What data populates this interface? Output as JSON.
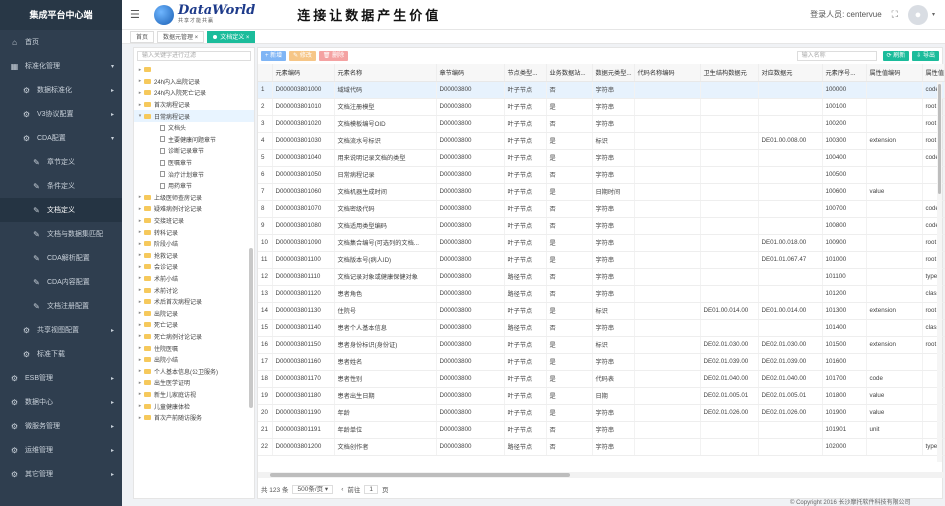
{
  "app": {
    "title": "集成平台中心端"
  },
  "sidebar": {
    "items": [
      {
        "label": "首页",
        "icon": "home-icon",
        "glyph": "⌂",
        "level": 0
      },
      {
        "label": "标准化管理",
        "icon": "grid-icon",
        "glyph": "▦",
        "level": 0,
        "arrow": "▾"
      },
      {
        "label": "数据标准化",
        "icon": "gear-icon",
        "glyph": "⚙",
        "level": 1,
        "arrow": "▸"
      },
      {
        "label": "V3协议配置",
        "icon": "gear-icon",
        "glyph": "⚙",
        "level": 1,
        "arrow": "▸"
      },
      {
        "label": "CDA配置",
        "icon": "gear-icon",
        "glyph": "⚙",
        "level": 1,
        "arrow": "▾"
      },
      {
        "label": "章节定义",
        "icon": "wrench-icon",
        "glyph": "✎",
        "level": 2
      },
      {
        "label": "条件定义",
        "icon": "wrench-icon",
        "glyph": "✎",
        "level": 2
      },
      {
        "label": "文档定义",
        "icon": "wrench-icon",
        "glyph": "✎",
        "level": 2,
        "active": true
      },
      {
        "label": "文档与数据集匹配",
        "icon": "wrench-icon",
        "glyph": "✎",
        "level": 2
      },
      {
        "label": "CDA解析配置",
        "icon": "wrench-icon",
        "glyph": "✎",
        "level": 2
      },
      {
        "label": "CDA内容配置",
        "icon": "wrench-icon",
        "glyph": "✎",
        "level": 2
      },
      {
        "label": "文档注册配置",
        "icon": "wrench-icon",
        "glyph": "✎",
        "level": 2
      },
      {
        "label": "共享视图配置",
        "icon": "gear-icon",
        "glyph": "⚙",
        "level": 1,
        "arrow": "▸"
      },
      {
        "label": "标准下载",
        "icon": "gear-icon",
        "glyph": "⚙",
        "level": 1
      },
      {
        "label": "ESB管理",
        "icon": "gear-icon",
        "glyph": "⚙",
        "level": 0,
        "arrow": "▸"
      },
      {
        "label": "数据中心",
        "icon": "gear-icon",
        "glyph": "⚙",
        "level": 0,
        "arrow": "▸"
      },
      {
        "label": "微服务管理",
        "icon": "gear-icon",
        "glyph": "⚙",
        "level": 0,
        "arrow": "▸"
      },
      {
        "label": "运维管理",
        "icon": "gear-icon",
        "glyph": "⚙",
        "level": 0,
        "arrow": "▸"
      },
      {
        "label": "其它管理",
        "icon": "gear-icon",
        "glyph": "⚙",
        "level": 0,
        "arrow": "▸"
      }
    ]
  },
  "header": {
    "brand_name": "DataWorld",
    "brand_sub": "共享才能共赢",
    "slogan": "连接让数据产生价值",
    "user_label": "登录人员: centervue",
    "menu_glyph": "☰",
    "expand_glyph": "⛶",
    "avatar_glyph": "●",
    "caret_glyph": "▾"
  },
  "tabs": [
    {
      "label": "首页",
      "active": false
    },
    {
      "label": "数据元管理 ×",
      "active": false
    },
    {
      "label": "文档定义 ×",
      "active": true
    }
  ],
  "tree": {
    "search_placeholder": "输入关键字进行过滤",
    "nodes": [
      {
        "label": "",
        "type": "folder",
        "tri": "▸",
        "indent": 0
      },
      {
        "label": "24h内入出院记录",
        "type": "folder",
        "tri": "▸",
        "indent": 0
      },
      {
        "label": "24h内入院死亡记录",
        "type": "folder",
        "tri": "▸",
        "indent": 0
      },
      {
        "label": "首次病程记录",
        "type": "folder",
        "tri": "▸",
        "indent": 0
      },
      {
        "label": "日常病程记录",
        "type": "folder",
        "tri": "▾",
        "indent": 0,
        "sel": true
      },
      {
        "label": "文档头",
        "type": "file",
        "tri": "",
        "indent": 1
      },
      {
        "label": "主要健康问题章节",
        "type": "file",
        "tri": "",
        "indent": 1
      },
      {
        "label": "诊断记录章节",
        "type": "file",
        "tri": "",
        "indent": 1
      },
      {
        "label": "医嘱章节",
        "type": "file",
        "tri": "",
        "indent": 1
      },
      {
        "label": "治疗计划章节",
        "type": "file",
        "tri": "",
        "indent": 1
      },
      {
        "label": "用药章节",
        "type": "file",
        "tri": "",
        "indent": 1
      },
      {
        "label": "上级医师查房记录",
        "type": "folder",
        "tri": "▸",
        "indent": 0
      },
      {
        "label": "疑难病例讨论记录",
        "type": "folder",
        "tri": "▸",
        "indent": 0
      },
      {
        "label": "交接班记录",
        "type": "folder",
        "tri": "▸",
        "indent": 0
      },
      {
        "label": "转科记录",
        "type": "folder",
        "tri": "▸",
        "indent": 0
      },
      {
        "label": "阶段小结",
        "type": "folder",
        "tri": "▸",
        "indent": 0
      },
      {
        "label": "抢救记录",
        "type": "folder",
        "tri": "▸",
        "indent": 0
      },
      {
        "label": "会诊记录",
        "type": "folder",
        "tri": "▸",
        "indent": 0
      },
      {
        "label": "术前小结",
        "type": "folder",
        "tri": "▸",
        "indent": 0
      },
      {
        "label": "术前讨论",
        "type": "folder",
        "tri": "▸",
        "indent": 0
      },
      {
        "label": "术后首次病程记录",
        "type": "folder",
        "tri": "▸",
        "indent": 0
      },
      {
        "label": "出院记录",
        "type": "folder",
        "tri": "▸",
        "indent": 0
      },
      {
        "label": "死亡记录",
        "type": "folder",
        "tri": "▸",
        "indent": 0
      },
      {
        "label": "死亡病例讨论记录",
        "type": "folder",
        "tri": "▸",
        "indent": 0
      },
      {
        "label": "住院医嘱",
        "type": "folder",
        "tri": "▸",
        "indent": 0
      },
      {
        "label": "出院小结",
        "type": "folder",
        "tri": "▸",
        "indent": 0
      },
      {
        "label": "个人基本信息(公卫服务)",
        "type": "folder",
        "tri": "▸",
        "indent": 0
      },
      {
        "label": "出生医学证明",
        "type": "folder",
        "tri": "▸",
        "indent": 0
      },
      {
        "label": "新生儿家庭访视",
        "type": "folder",
        "tri": "▸",
        "indent": 0
      },
      {
        "label": "儿童健康体检",
        "type": "folder",
        "tri": "▸",
        "indent": 0
      },
      {
        "label": "首次产前随访服务",
        "type": "folder",
        "tri": "▸",
        "indent": 0
      }
    ]
  },
  "toolbar": {
    "add": "+ 新增",
    "edit": "✎ 修改",
    "delete": "🗑 删除",
    "search_placeholder": "输入名称",
    "refresh": "⟳ 刷新",
    "export": "⇩ 导出"
  },
  "table": {
    "columns": [
      "",
      "元素编码",
      "元素名称",
      "章节编码",
      "节点类型...",
      "业务数据站...",
      "数据元类型...",
      "代码名称编码",
      "卫生结构数据元",
      "对应数据元",
      "元素序号...",
      "属性值编码",
      "属性值..."
    ],
    "rows": [
      [
        "1",
        "D000003801000",
        "域域代码",
        "D00003800",
        "叶子节点",
        "否",
        "字符串",
        "",
        "",
        "",
        "100000",
        "",
        "code"
      ],
      [
        "2",
        "D000003801010",
        "文档注册模型",
        "D00003800",
        "叶子节点",
        "是",
        "字符串",
        "",
        "",
        "",
        "100100",
        "",
        "root"
      ],
      [
        "3",
        "D000003801020",
        "文档模板编号OID",
        "D00003800",
        "叶子节点",
        "否",
        "字符串",
        "",
        "",
        "",
        "100200",
        "",
        "root"
      ],
      [
        "4",
        "D000003801030",
        "文档流水号标识",
        "D00003800",
        "叶子节点",
        "是",
        "标识",
        "",
        "",
        "DE01.00.008.00",
        "100300",
        "extension",
        "root"
      ],
      [
        "5",
        "D000003801040",
        "用来说明记录文档的类型",
        "D00003800",
        "叶子节点",
        "是",
        "字符串",
        "",
        "",
        "",
        "100400",
        "",
        "code"
      ],
      [
        "6",
        "D000003801050",
        "日常病程记录",
        "D00003800",
        "叶子节点",
        "否",
        "字符串",
        "",
        "",
        "",
        "100500",
        "",
        ""
      ],
      [
        "7",
        "D000003801060",
        "文档机器生成时间",
        "D00003800",
        "叶子节点",
        "是",
        "日期时间",
        "",
        "",
        "",
        "100600",
        "value",
        ""
      ],
      [
        "8",
        "D000003801070",
        "文档密级代码",
        "D00003800",
        "叶子节点",
        "否",
        "字符串",
        "",
        "",
        "",
        "100700",
        "",
        "code"
      ],
      [
        "9",
        "D000003801080",
        "文档适用类型编码",
        "D00003800",
        "叶子节点",
        "否",
        "字符串",
        "",
        "",
        "",
        "100800",
        "",
        "code"
      ],
      [
        "10",
        "D000003801090",
        "文档集合编号(可选列的文档...",
        "D00003800",
        "叶子节点",
        "是",
        "字符串",
        "",
        "",
        "DE01.00.018.00",
        "100900",
        "",
        "root"
      ],
      [
        "11",
        "D000003801100",
        "文档版本号(病人ID)",
        "D00003800",
        "叶子节点",
        "是",
        "字符串",
        "",
        "",
        "DE01.01.067.47",
        "101000",
        "",
        "root"
      ],
      [
        "12",
        "D000003801110",
        "文档记录对象或健康保健对象",
        "D00003800",
        "路径节点",
        "否",
        "字符串",
        "",
        "",
        "",
        "101100",
        "",
        "type"
      ],
      [
        "13",
        "D000003801120",
        "患者角色",
        "D00003800",
        "路径节点",
        "否",
        "字符串",
        "",
        "",
        "",
        "101200",
        "",
        "class"
      ],
      [
        "14",
        "D000003801130",
        "住院号",
        "D00003800",
        "叶子节点",
        "是",
        "标识",
        "",
        "DE01.00.014.00",
        "DE01.00.014.00",
        "101300",
        "extension",
        "root"
      ],
      [
        "15",
        "D000003801140",
        "患者个人基本信息",
        "D00003800",
        "路径节点",
        "否",
        "字符串",
        "",
        "",
        "",
        "101400",
        "",
        "class"
      ],
      [
        "16",
        "D000003801150",
        "患者身份标识(身份证)",
        "D00003800",
        "叶子节点",
        "是",
        "标识",
        "",
        "DE02.01.030.00",
        "DE02.01.030.00",
        "101500",
        "extension",
        "root"
      ],
      [
        "17",
        "D000003801160",
        "患者姓名",
        "D00003800",
        "叶子节点",
        "是",
        "字符串",
        "",
        "DE02.01.039.00",
        "DE02.01.039.00",
        "101600",
        "",
        ""
      ],
      [
        "18",
        "D000003801170",
        "患者性别",
        "D00003800",
        "叶子节点",
        "是",
        "代码表",
        "",
        "DE02.01.040.00",
        "DE02.01.040.00",
        "101700",
        "code",
        ""
      ],
      [
        "19",
        "D000003801180",
        "患者出生日期",
        "D00003800",
        "叶子节点",
        "是",
        "日期",
        "",
        "DE02.01.005.01",
        "DE02.01.005.01",
        "101800",
        "value",
        ""
      ],
      [
        "20",
        "D000003801190",
        "年龄",
        "D00003800",
        "叶子节点",
        "是",
        "字符串",
        "",
        "DE02.01.026.00",
        "DE02.01.026.00",
        "101900",
        "value",
        ""
      ],
      [
        "21",
        "D000003801191",
        "年龄单位",
        "D00003800",
        "叶子节点",
        "否",
        "字符串",
        "",
        "",
        "",
        "101901",
        "unit",
        ""
      ],
      [
        "22",
        "D000003801200",
        "文档创作者",
        "D00003800",
        "路径节点",
        "否",
        "字符串",
        "",
        "",
        "",
        "102000",
        "",
        "type"
      ]
    ]
  },
  "pager": {
    "total": "共 123 条",
    "page_size": "500条/页 ▾",
    "prev": "‹",
    "goto_label": "前往",
    "page": "1",
    "page_suffix": "页"
  },
  "footer": {
    "copyright": "© Copyright 2016 长沙摩托软件科技有限公司"
  }
}
